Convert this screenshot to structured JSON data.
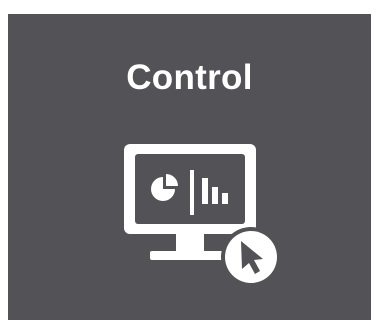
{
  "tile": {
    "title": "Control",
    "background_color": "#535357",
    "foreground_color": "#ffffff",
    "icon": "monitor-dashboard-with-cursor-icon"
  }
}
